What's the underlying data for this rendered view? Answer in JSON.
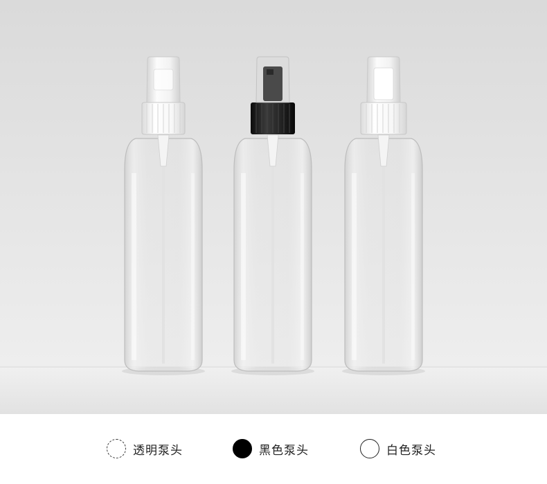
{
  "legend": {
    "items": [
      {
        "label": "透明泵头",
        "swatch": "dashed-clear-circle",
        "color": "#ffffff"
      },
      {
        "label": "黑色泵头",
        "swatch": "filled-black-circle",
        "color": "#000000"
      },
      {
        "label": "白色泵头",
        "swatch": "outlined-white-circle",
        "color": "#ffffff"
      }
    ]
  },
  "photo": {
    "background": "#e4e4e4",
    "bottles": [
      {
        "pump_color": "#f4f4f4",
        "pump": "clear"
      },
      {
        "pump_color": "#1a1a1a",
        "pump": "black"
      },
      {
        "pump_color": "#fbfbfb",
        "pump": "white"
      }
    ]
  }
}
